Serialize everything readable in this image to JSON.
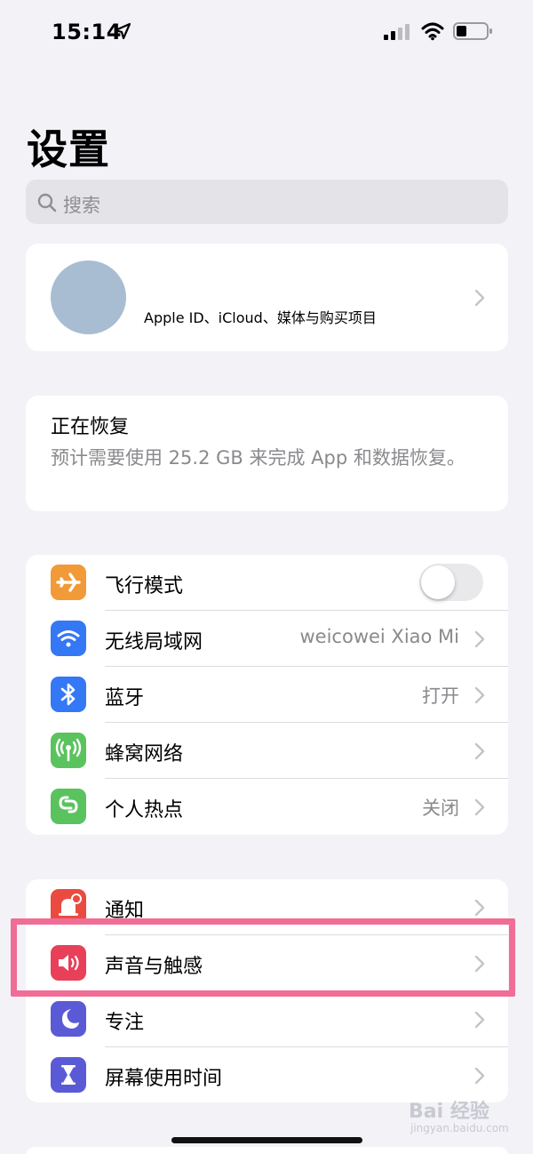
{
  "status_bar": {
    "time": "15:14"
  },
  "title": "设置",
  "search": {
    "placeholder": "搜索"
  },
  "profile": {
    "subtitle": "Apple ID、iCloud、媒体与购买项目"
  },
  "restore": {
    "title": "正在恢复",
    "description": "预计需要使用 25.2 GB 来完成 App 和数据恢复。"
  },
  "network_group": [
    {
      "label": "飞行模式",
      "icon": "airplane-icon",
      "color": "#f19a37",
      "toggle": false
    },
    {
      "label": "无线局域网",
      "icon": "wifi-icon",
      "color": "#3478f6",
      "value": "weicowei Xiao Mi"
    },
    {
      "label": "蓝牙",
      "icon": "bluetooth-icon",
      "color": "#3478f6",
      "value": "打开"
    },
    {
      "label": "蜂窝网络",
      "icon": "cellular-icon",
      "color": "#5ac35e",
      "value": ""
    },
    {
      "label": "个人热点",
      "icon": "hotspot-icon",
      "color": "#5ac35e",
      "value": "关闭"
    }
  ],
  "notification_group": [
    {
      "label": "通知",
      "icon": "notification-icon",
      "color": "#ea4b40"
    },
    {
      "label": "声音与触感",
      "icon": "speaker-icon",
      "color": "#e9405a",
      "highlighted": true
    },
    {
      "label": "专注",
      "icon": "moon-icon",
      "color": "#5b5ad6"
    },
    {
      "label": "屏幕使用时间",
      "icon": "hourglass-icon",
      "color": "#5b5ad6"
    }
  ],
  "watermark": {
    "text": "Bai 经验",
    "sub": "jingyan.baidu.com"
  },
  "colors": {
    "highlight": "#f06d95",
    "background": "#f2f2f7"
  }
}
